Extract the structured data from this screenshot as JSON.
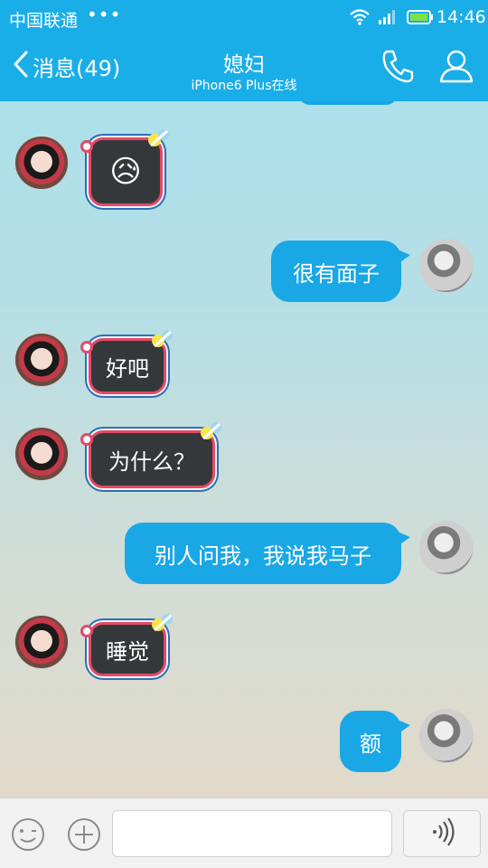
{
  "status_bar": {
    "carrier": "中国联通",
    "dots": "•••",
    "time": "14:46"
  },
  "header": {
    "back_label": "消息(49)",
    "title": "媳妇",
    "subtitle": "iPhone6 Plus在线"
  },
  "messages": [
    {
      "side": "in",
      "text": "😥"
    },
    {
      "side": "out",
      "text": "很有面子"
    },
    {
      "side": "in",
      "text": "好吧"
    },
    {
      "side": "in",
      "text": "为什么？"
    },
    {
      "side": "out",
      "text": "别人问我，我说我马子"
    },
    {
      "side": "in",
      "text": "睡觉"
    },
    {
      "side": "out",
      "text": "额"
    }
  ],
  "input": {
    "value": "",
    "placeholder": ""
  },
  "colors": {
    "brand": "#1aaee8",
    "outgoing_bubble": "#1aa7e6",
    "incoming_bubble": "#34383b",
    "incoming_border": "#e24a67"
  },
  "icons": [
    "back-chevron-icon",
    "phone-icon",
    "profile-icon",
    "emoji-icon",
    "plus-icon",
    "voice-icon",
    "wifi-icon",
    "signal-icon",
    "battery-icon"
  ]
}
